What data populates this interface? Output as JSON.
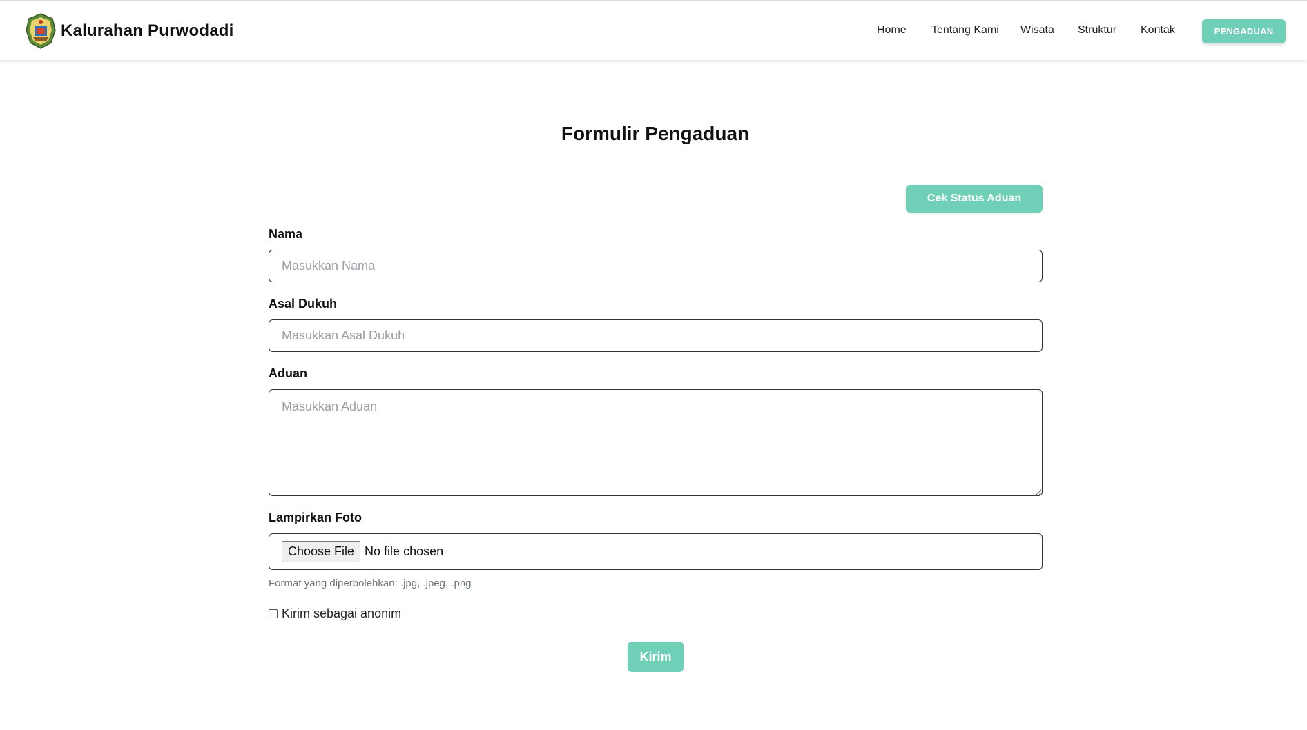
{
  "brand": {
    "name": "Kalurahan Purwodadi",
    "logo_icon": "village-emblem-icon"
  },
  "nav": {
    "links": [
      "Home",
      "Tentang Kami",
      "Wisata",
      "Struktur",
      "Kontak"
    ],
    "cta_label": "PENGADUAN"
  },
  "form": {
    "title": "Formulir Pengaduan",
    "status_button": "Cek Status Aduan",
    "nama": {
      "label": "Nama",
      "placeholder": "Masukkan Nama"
    },
    "dukuh": {
      "label": "Asal Dukuh",
      "placeholder": "Masukkan Asal Dukuh"
    },
    "aduan": {
      "label": "Aduan",
      "placeholder": "Masukkan Aduan"
    },
    "foto": {
      "label": "Lampirkan Foto",
      "choose_label": "Choose File",
      "status": "No file chosen",
      "help": "Format yang diperbolehkan: .jpg, .jpeg, .png"
    },
    "anonim_label": "Kirim sebagai anonim",
    "submit_label": "Kirim"
  },
  "colors": {
    "accent": "#6fcfb7",
    "text": "#111111",
    "muted": "#6c757d"
  }
}
